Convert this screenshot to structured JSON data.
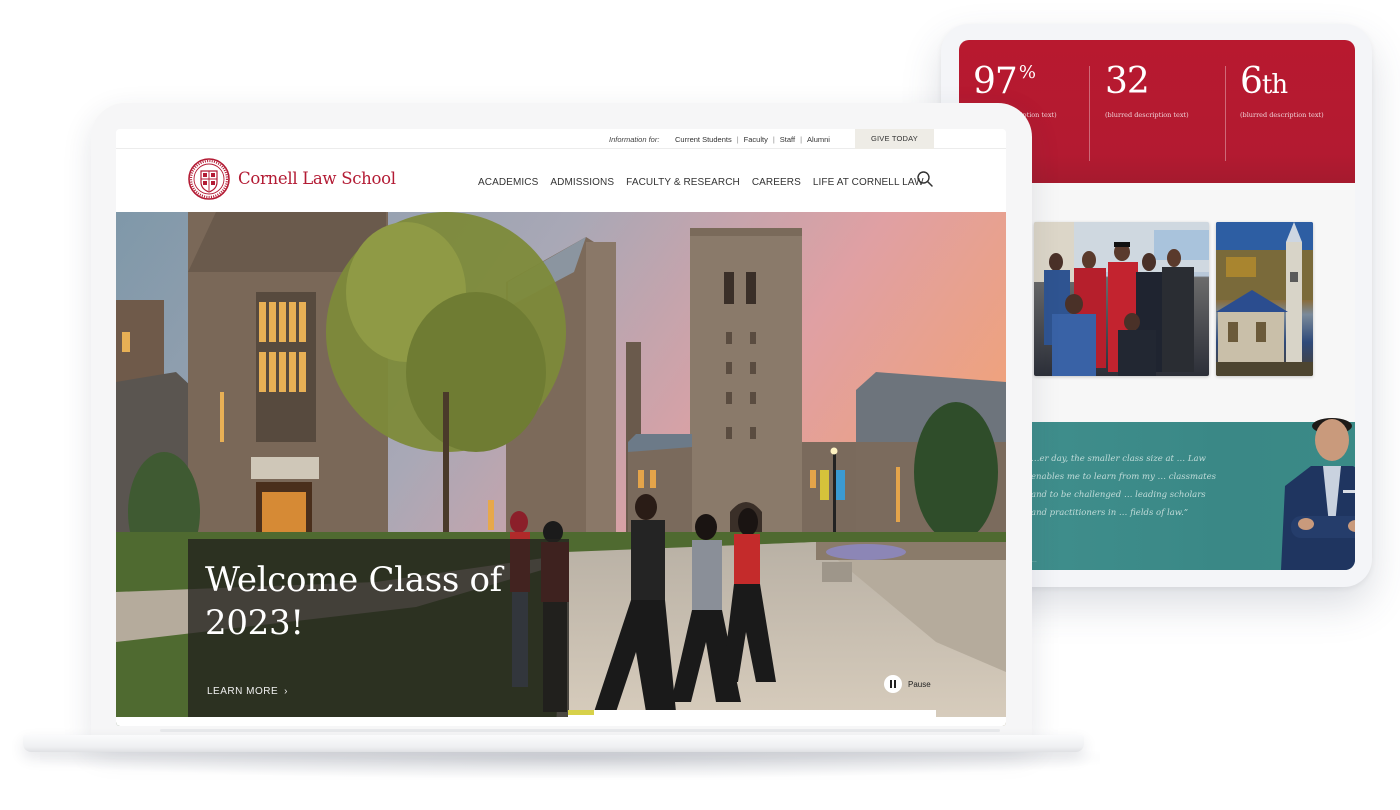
{
  "colors": {
    "brand_red": "#b31b34",
    "stats_red": "#b8192f",
    "testimonial_teal": "#3f8e8c",
    "progress_yellow": "#d7d14a",
    "give_bg": "#eeece6"
  },
  "laptop": {
    "utility_bar": {
      "label": "Information for:",
      "links": [
        "Current Students",
        "Faculty",
        "Staff",
        "Alumni"
      ],
      "give_button": "GIVE TODAY"
    },
    "header": {
      "logo_text": "Cornell Law School",
      "logo_icon": "cornell-seal-icon",
      "nav": [
        "ACADEMICS",
        "ADMISSIONS",
        "FACULTY & RESEARCH",
        "CAREERS",
        "LIFE AT CORNELL LAW"
      ],
      "search_icon": "search-icon"
    },
    "hero": {
      "title": "Welcome Class of 2023!",
      "link_label": "LEARN MORE",
      "link_icon": "chevron-right-icon",
      "pause_label": "Pause",
      "pause_icon": "pause-icon",
      "slide_progress_percent": 7
    }
  },
  "tablet": {
    "stats": [
      {
        "value": "97",
        "sup": "%",
        "suffix": "",
        "description": "(blurred description text)"
      },
      {
        "value": "32",
        "sup": "",
        "suffix": "",
        "description": "(blurred description text)"
      },
      {
        "value": "6",
        "sup": "",
        "suffix": "th",
        "description": "(blurred description text)"
      }
    ],
    "testimonial": {
      "quote": "…er day, the smaller class size at … Law enables me to learn from my … classmates and to be challenged … leading scholars and practitioners in … fields of law.”",
      "attribution": "…"
    }
  }
}
